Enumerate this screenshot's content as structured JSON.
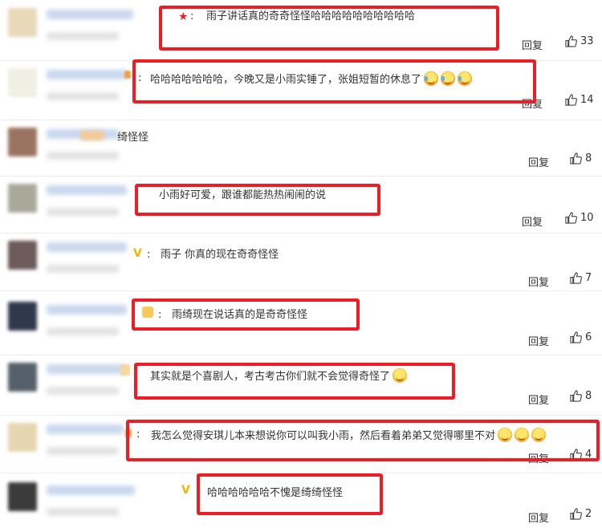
{
  "reply_label": "回复",
  "colors": {
    "highlight": "#ee1c25",
    "text": "#333333"
  },
  "comments": [
    {
      "text": "雨子讲话真的奇奇怪怪哈哈哈哈哈哈哈哈哈哈",
      "likes": "33",
      "emblem": "star"
    },
    {
      "text": "哈哈哈哈哈哈哈，今晚又是小雨实锤了，张姐短暂的休息了",
      "likes": "14",
      "emojis": [
        "cry-laugh",
        "cry-laugh",
        "cry-laugh"
      ]
    },
    {
      "text": "绮怪怪",
      "likes": "8"
    },
    {
      "text": "小雨好可爱，跟谁都能热热闹闹的说",
      "likes": "10"
    },
    {
      "text": "雨子 你真的现在奇奇怪怪",
      "likes": "7",
      "emblem": "v"
    },
    {
      "text": "雨绮现在说话真的是奇奇怪怪",
      "likes": "6",
      "emblem": "badge"
    },
    {
      "text": "其实就是个喜剧人，考古考古你们就不会觉得奇怪了",
      "likes": "8",
      "emojis": [
        "wink"
      ]
    },
    {
      "text": "我怎么觉得安琪儿本来想说你可以叫我小雨，然后看着弟弟又觉得哪里不对",
      "likes": "4",
      "emojis": [
        "laugh",
        "laugh",
        "laugh"
      ]
    },
    {
      "text": "哈哈哈哈哈哈不愧是绮绮怪怪",
      "likes": "2",
      "emblem": "v"
    }
  ]
}
